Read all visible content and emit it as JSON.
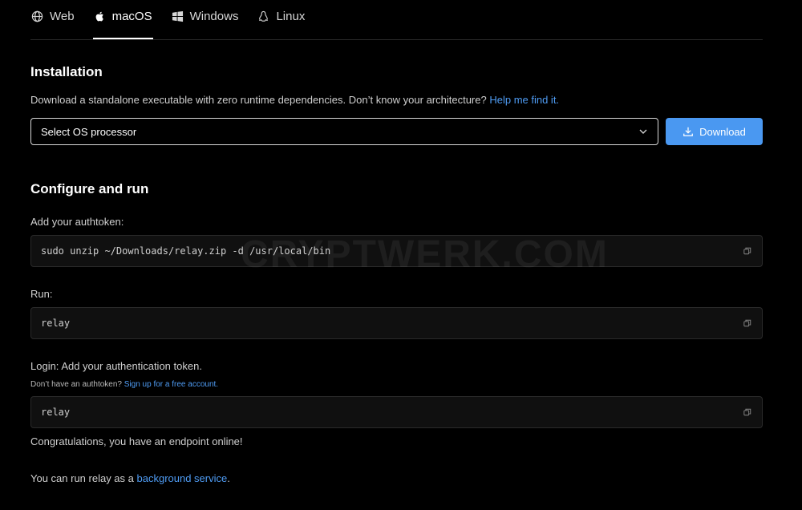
{
  "tabs": [
    {
      "label": "Web",
      "icon": "globe-icon"
    },
    {
      "label": "macOS",
      "icon": "apple-icon"
    },
    {
      "label": "Windows",
      "icon": "windows-icon"
    },
    {
      "label": "Linux",
      "icon": "linux-icon"
    }
  ],
  "active_tab": "macOS",
  "installation": {
    "title": "Installation",
    "description": "Download a standalone executable with zero runtime dependencies. Don’t know your architecture?",
    "help_link": "Help me find it.",
    "select_placeholder": "Select OS processor",
    "download_label": "Download"
  },
  "configure": {
    "title": "Configure and run",
    "authtoken_label": "Add your authtoken:",
    "authtoken_command": "sudo unzip ~/Downloads/relay.zip -d /usr/local/bin",
    "run_label": "Run:",
    "run_command": "relay",
    "login_label": "Login: Add your authentication token.",
    "no_token_text": "Don’t have an authtoken?",
    "signup_link": "Sign up for a free account.",
    "login_command": "relay",
    "congrats": "Congratulations, you have an endpoint online!",
    "background_prefix": "You can run relay as a",
    "background_link": "background service",
    "background_suffix": "."
  },
  "watermark": "CRYPTWERK.COM",
  "colors": {
    "background": "#000000",
    "accent": "#4a98f1",
    "link": "#4f9cf4",
    "code_bg": "#101010"
  }
}
